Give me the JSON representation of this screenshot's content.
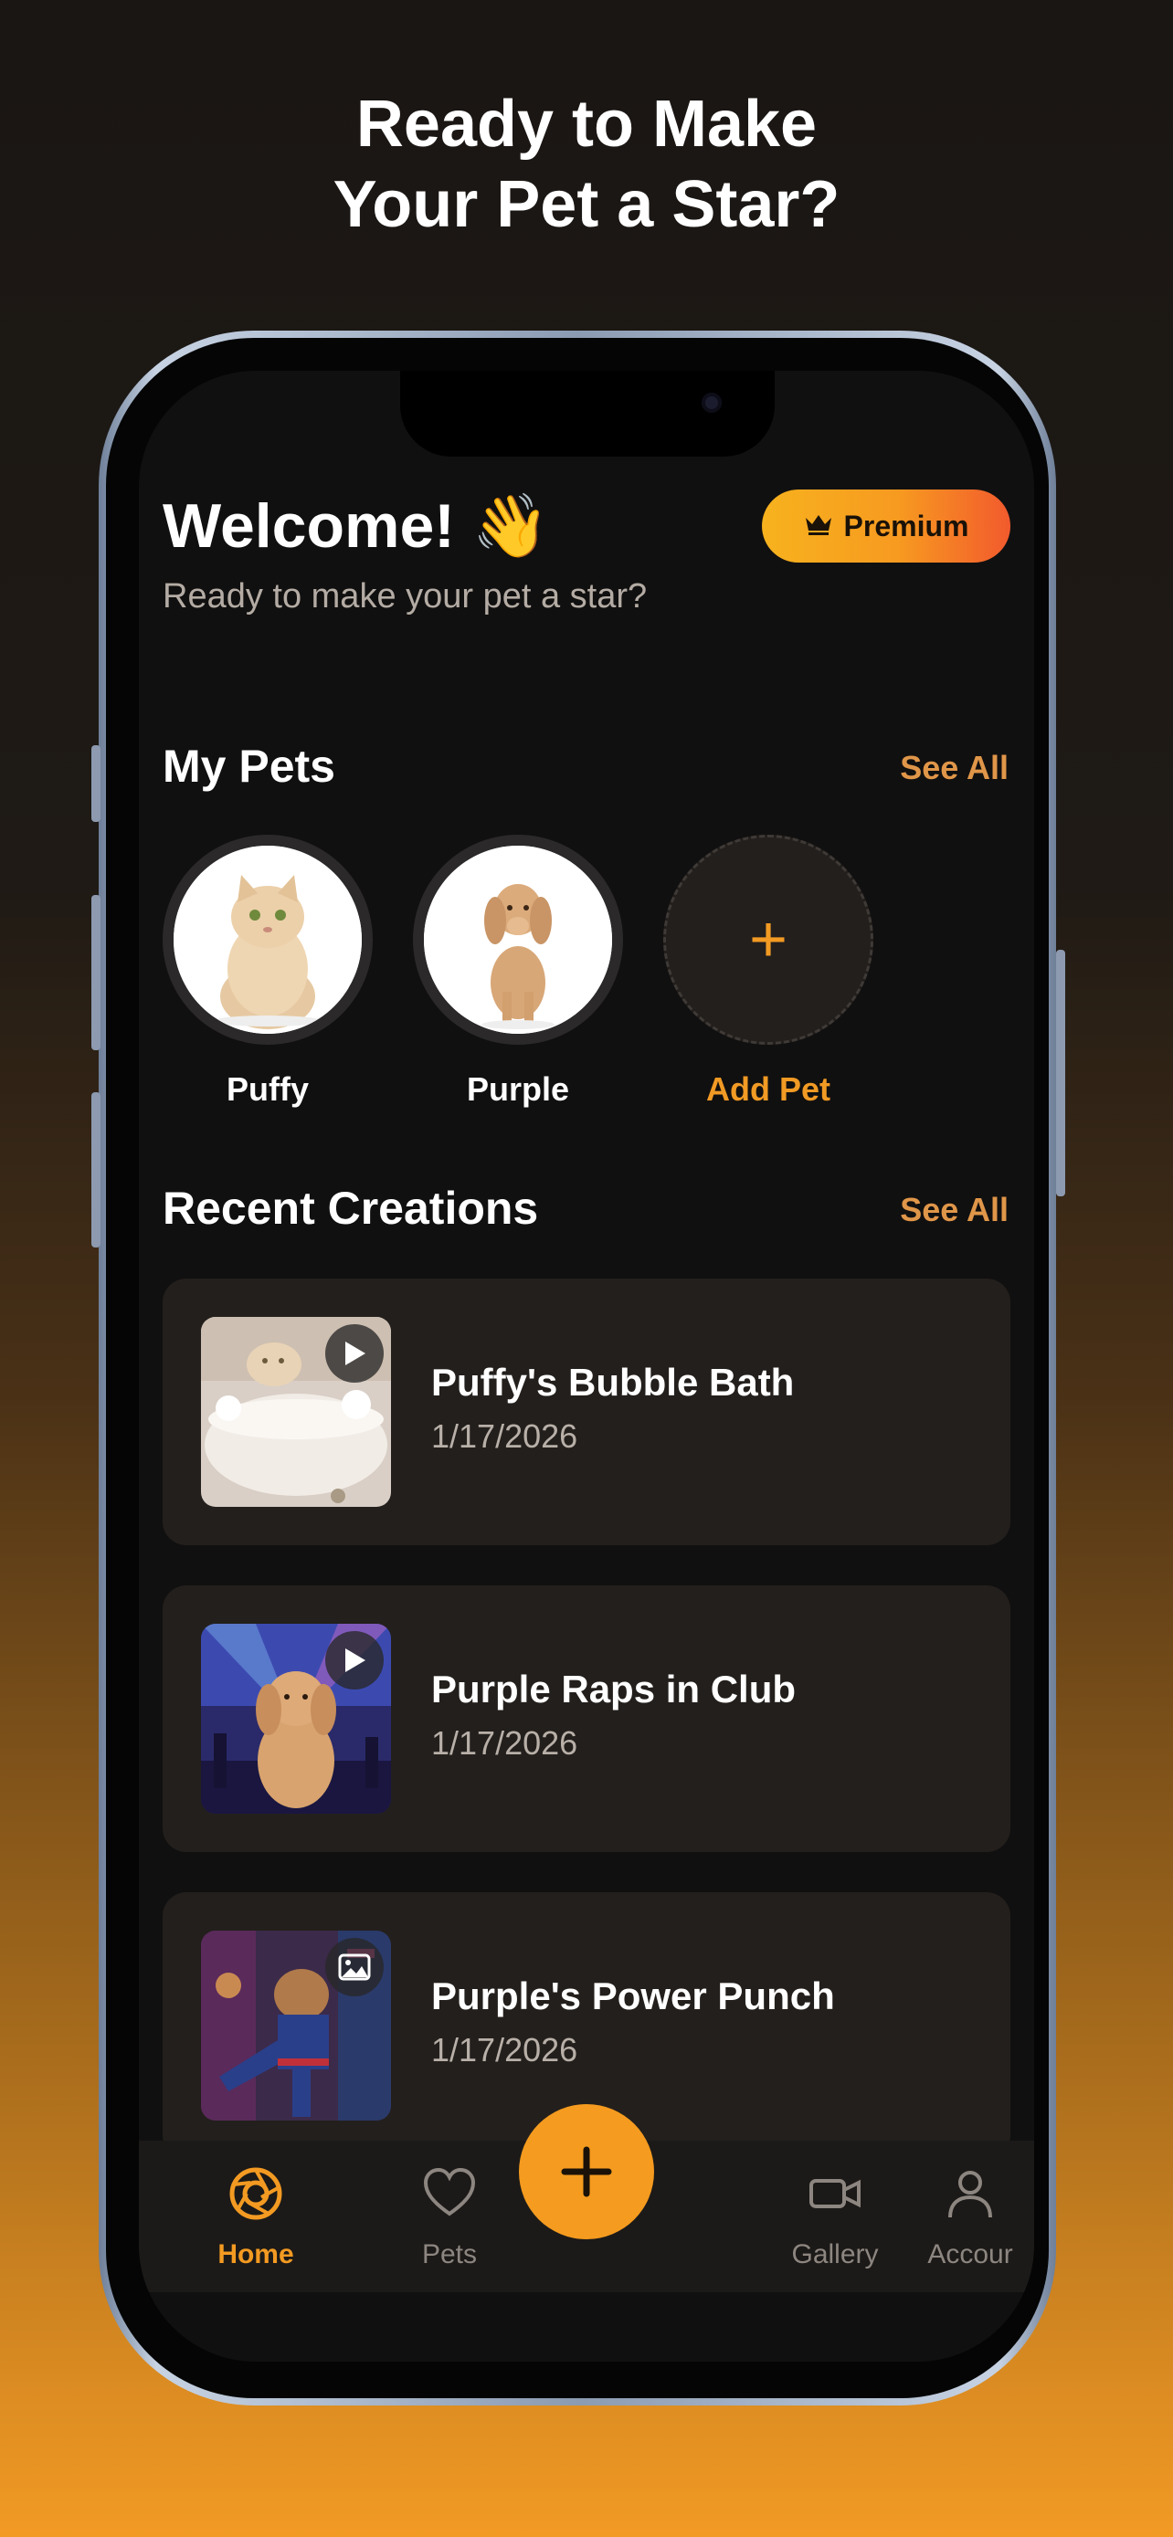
{
  "headline": {
    "line1": "Ready to Make",
    "line2": "Your Pet a Star?"
  },
  "header": {
    "welcome": "Welcome! 👋",
    "subtitle": "Ready to make your pet a star?",
    "premium_label": "Premium"
  },
  "my_pets": {
    "title": "My Pets",
    "see_all": "See All",
    "pets": [
      {
        "name": "Puffy"
      },
      {
        "name": "Purple"
      }
    ],
    "add_label": "Add Pet"
  },
  "recent": {
    "title": "Recent Creations",
    "see_all": "See All",
    "items": [
      {
        "title": "Puffy's Bubble Bath",
        "date": "1/17/2026",
        "type": "video"
      },
      {
        "title": "Purple Raps in Club",
        "date": "1/17/2026",
        "type": "video"
      },
      {
        "title": "Purple's Power Punch",
        "date": "1/17/2026",
        "type": "image"
      }
    ]
  },
  "tabbar": {
    "home": "Home",
    "pets": "Pets",
    "gallery": "Gallery",
    "account": "Accour"
  },
  "colors": {
    "accent": "#f59b1f",
    "accent_text": "#e09649",
    "card": "#231f1c",
    "screen_bg": "#111010"
  }
}
